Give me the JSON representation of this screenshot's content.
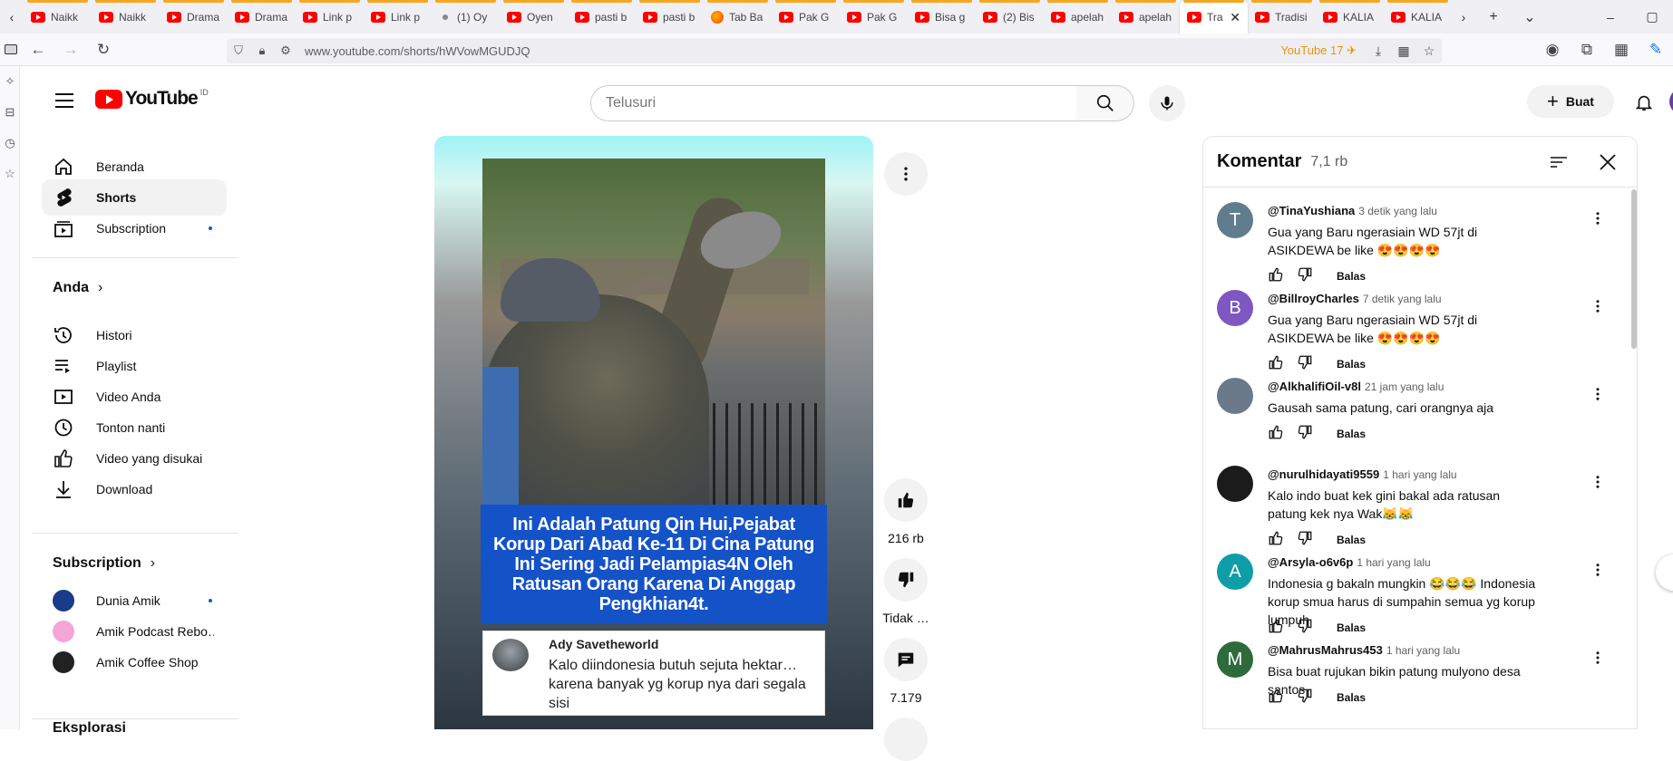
{
  "browser": {
    "tabs": [
      {
        "label": "Naikk",
        "icon": "yt"
      },
      {
        "label": "Naikk",
        "icon": "yt"
      },
      {
        "label": "Drama",
        "icon": "yt"
      },
      {
        "label": "Drama",
        "icon": "yt"
      },
      {
        "label": "Link p",
        "icon": "yt"
      },
      {
        "label": "Link p",
        "icon": "yt"
      },
      {
        "label": "(1) Oy",
        "icon": "dot"
      },
      {
        "label": "Oyen",
        "icon": "yt"
      },
      {
        "label": "pasti b",
        "icon": "yt"
      },
      {
        "label": "pasti b",
        "icon": "yt"
      },
      {
        "label": "Tab Ba",
        "icon": "firefox"
      },
      {
        "label": "Pak G",
        "icon": "yt"
      },
      {
        "label": "Pak G",
        "icon": "yt"
      },
      {
        "label": "Bisa g",
        "icon": "yt"
      },
      {
        "label": "(2) Bis",
        "icon": "yt"
      },
      {
        "label": "apelah",
        "icon": "yt"
      },
      {
        "label": "apelah",
        "icon": "yt"
      },
      {
        "label": "Tra",
        "icon": "yt",
        "active": true
      },
      {
        "label": "Tradisi",
        "icon": "yt"
      },
      {
        "label": "KALIA",
        "icon": "yt"
      },
      {
        "label": "KALIA",
        "icon": "yt"
      }
    ],
    "url": "www.youtube.com/shorts/hWVowMGUDJQ",
    "extension_label": "YouTube 17"
  },
  "header": {
    "logo_text": "YouTube",
    "region": "ID",
    "search_placeholder": "Telusuri",
    "create_label": "Buat"
  },
  "guide": {
    "main": [
      {
        "label": "Beranda",
        "icon": "home-icon"
      },
      {
        "label": "Shorts",
        "icon": "shorts-icon",
        "active": true
      },
      {
        "label": "Subscription",
        "icon": "subscriptions-icon",
        "dot": true
      }
    ],
    "you_header": "Anda",
    "you": [
      {
        "label": "Histori",
        "icon": "history-icon"
      },
      {
        "label": "Playlist",
        "icon": "playlist-icon"
      },
      {
        "label": "Video Anda",
        "icon": "your-videos-icon"
      },
      {
        "label": "Tonton nanti",
        "icon": "watch-later-icon"
      },
      {
        "label": "Video yang disukai",
        "icon": "liked-icon"
      },
      {
        "label": "Download",
        "icon": "download-icon"
      }
    ],
    "subs_header": "Subscription",
    "subs": [
      {
        "label": "Dunia Amik",
        "color": "#1a3a8a",
        "dot": true
      },
      {
        "label": "Amik Podcast Rebo…",
        "color": "#f4a6d7"
      },
      {
        "label": "Amik Coffee Shop",
        "color": "#222222"
      }
    ],
    "explore_header": "Eksplorasi"
  },
  "video": {
    "caption": "Ini Adalah Patung Qin Hui,Pejabat Korup Dari Abad Ke-11 Di Cina Patung Ini Sering Jadi Pelampias4N Oleh Ratusan Orang Karena Di Anggap Pengkhian4t.",
    "overlay_comment": {
      "name": "Ady Savetheworld",
      "text": "Kalo diindonesia butuh sejuta hektar… karena banyak yg korup nya dari segala sisi"
    }
  },
  "actions": {
    "likes": "216 rb",
    "dislike": "Tidak …",
    "comments": "7.179"
  },
  "comments_panel": {
    "title": "Komentar",
    "count": "7,1 rb",
    "reply_label": "Balas",
    "items": [
      {
        "author": "@TinaYushiana",
        "time": "3 detik yang lalu",
        "text": "Gua yang Baru ngerasiain WD 57jt di ASIKDEWA be like 😍😍😍😍",
        "initial": "T",
        "color": "#5f7d8c"
      },
      {
        "author": "@BillroyCharles",
        "time": "7 detik yang lalu",
        "text": "Gua yang Baru ngerasiain WD 57jt di ASIKDEWA be like 😍😍😍😍",
        "initial": "B",
        "color": "#7e57c2"
      },
      {
        "author": "@AlkhalifiOil-v8l",
        "time": "21 jam yang lalu",
        "text": "Gausah sama patung, cari orangnya aja",
        "initial": "",
        "color": "#6b7a8a"
      },
      {
        "author": "@nurulhidayati9559",
        "time": "1 hari yang lalu",
        "text": "Kalo indo buat kek gini bakal ada ratusan patung kek nya Wak😹😹",
        "initial": "",
        "color": "#1b1b1b"
      },
      {
        "author": "@Arsyla-o6v6p",
        "time": "1 hari yang lalu",
        "text": "Indonesia g bakaln mungkin 😂😂😂 Indonesia korup smua harus di sumpahin semua yg korup lumpuh",
        "initial": "A",
        "color": "#0d9ea8"
      },
      {
        "author": "@MahrusMahrus453",
        "time": "1 hari yang lalu",
        "text": "Bisa buat rujukan bikin patung mulyono desa santos",
        "initial": "M",
        "color": "#2e6b3a"
      }
    ]
  }
}
